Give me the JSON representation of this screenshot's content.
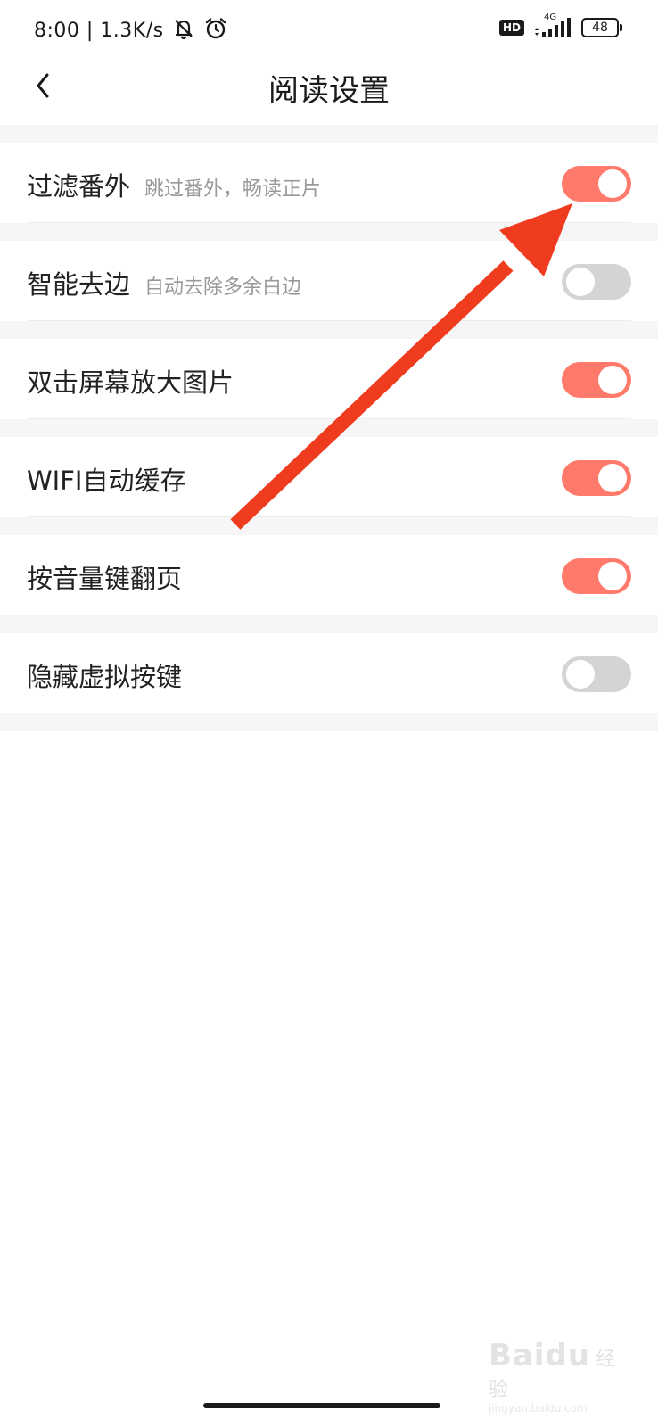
{
  "status_bar": {
    "time_and_speed": "8:00 | 1.3K/s",
    "hd_label": "HD",
    "network_label": "4G",
    "battery_level": "48"
  },
  "header": {
    "title": "阅读设置"
  },
  "settings": [
    {
      "title": "过滤番外",
      "subtitle": "跳过番外，畅读正片",
      "enabled": true
    },
    {
      "title": "智能去边",
      "subtitle": "自动去除多余白边",
      "enabled": false
    },
    {
      "title": "双击屏幕放大图片",
      "subtitle": "",
      "enabled": true
    },
    {
      "title": "WIFI自动缓存",
      "subtitle": "",
      "enabled": true
    },
    {
      "title": "按音量键翻页",
      "subtitle": "",
      "enabled": true
    },
    {
      "title": "隐藏虚拟按键",
      "subtitle": "",
      "enabled": false
    }
  ],
  "watermark": {
    "logo": "Baidu",
    "tag": "经验",
    "url": "jingyan.baidu.com"
  },
  "colors": {
    "toggle_on": "#ff7a6b",
    "toggle_off": "#d4d4d4",
    "annotation_arrow": "#f03c1e"
  }
}
